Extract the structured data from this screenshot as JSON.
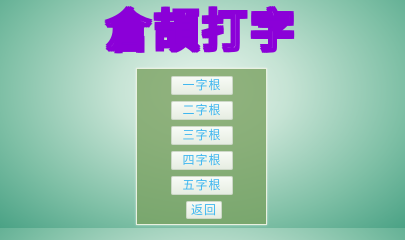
{
  "title": "倉頡打字",
  "menu": {
    "buttons": [
      {
        "label": "一字根"
      },
      {
        "label": "二字根"
      },
      {
        "label": "三字根"
      },
      {
        "label": "四字根"
      },
      {
        "label": "五字根"
      }
    ],
    "back_label": "返回"
  },
  "colors": {
    "title_outline": "#8b00d8",
    "button_text": "#3fb7f0",
    "panel": "#78a05f",
    "background": "#4aa285"
  }
}
